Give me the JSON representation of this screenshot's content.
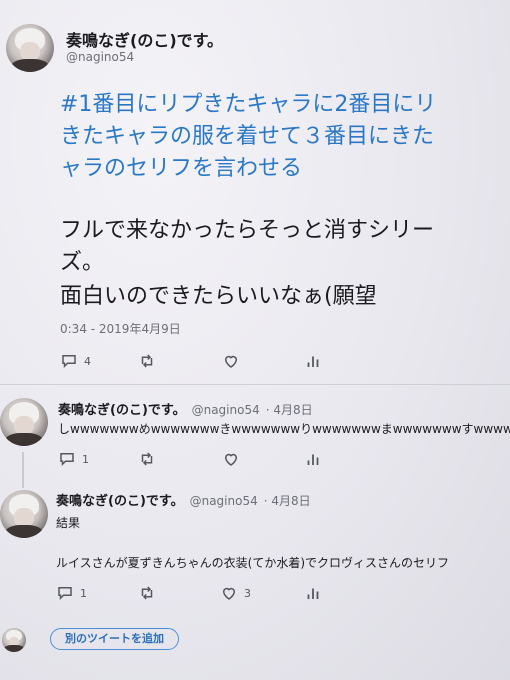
{
  "main_tweet": {
    "display_name": "奏鳴なぎ(のこ)です。",
    "handle": "@nagino54",
    "hashtag_lines": [
      "#1番目にリプきたキャラに2番目にリ",
      "きたキャラの服を着せて３番目にきた",
      "ャラのセリフを言わせる"
    ],
    "body_lines": [
      "フルで来なかったらそっと消すシリー",
      "ズ。",
      "面白いのできたらいいなぁ(願望"
    ],
    "timestamp": "0:34 - 2019年4月9日",
    "actions": {
      "reply_count": "4",
      "retweet_count": "",
      "like_count": ""
    }
  },
  "replies": [
    {
      "display_name": "奏鳴なぎ(のこ)です。",
      "handle": "@nagino54",
      "date": "· 4月8日",
      "text": "しwwwwwwwめwwwwwwwきwwwwwwwりwwwwwwwまwwwwwwwすwwwwwwww",
      "actions": {
        "reply_count": "1",
        "retweet_count": "",
        "like_count": ""
      }
    },
    {
      "display_name": "奏鳴なぎ(のこ)です。",
      "handle": "@nagino54",
      "date": "· 4月8日",
      "text_lines": [
        "結果",
        "ルイスさんが夏ずきんちゃんの衣装(てか水着)でクロヴィスさんのセリフ"
      ],
      "actions": {
        "reply_count": "1",
        "retweet_count": "",
        "like_count": "3"
      }
    }
  ],
  "compose": {
    "add_tweet_label": "別のツイートを追加"
  },
  "icons": [
    "reply-icon",
    "retweet-icon",
    "like-icon",
    "analytics-icon"
  ],
  "colors": {
    "link_blue": "#2a78c5",
    "text": "#1b1b1f",
    "muted": "#6c6f77"
  }
}
